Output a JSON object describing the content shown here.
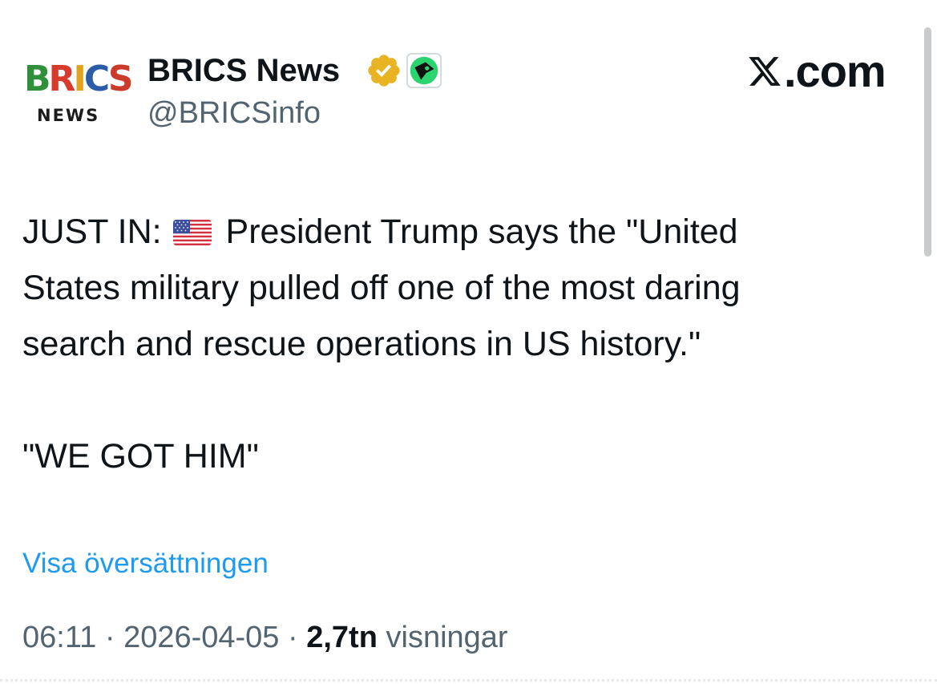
{
  "colors": {
    "text": "#0f1419",
    "secondary": "#536471",
    "link": "#1d9bf0",
    "verified_gold": "#e8b423"
  },
  "account": {
    "avatar": {
      "logo_letters": [
        "B",
        "R",
        "I",
        "C",
        "S"
      ],
      "logo_sub": "NEWS"
    },
    "display_name": "BRICS News",
    "handle": "@BRICSinfo",
    "badges": [
      "gold-verified-badge-icon",
      "affiliate-badge-icon"
    ]
  },
  "site": {
    "logo_icon": "x-logo-icon",
    "suffix": ".com"
  },
  "tweet": {
    "line1_before_flag": "JUST IN:",
    "flag_icon": "us-flag-icon",
    "line1_after_flag": "President Trump says the \"United",
    "line2": "States military pulled off one of the most daring",
    "line3": "search and rescue operations in US history.\"",
    "quote": "\"WE GOT HIM\""
  },
  "translate_link": "Visa översättningen",
  "meta": {
    "time": "06:11",
    "date": "2026-04-05",
    "separator": "·",
    "views_count": "2,7tn",
    "views_label": "visningar"
  }
}
